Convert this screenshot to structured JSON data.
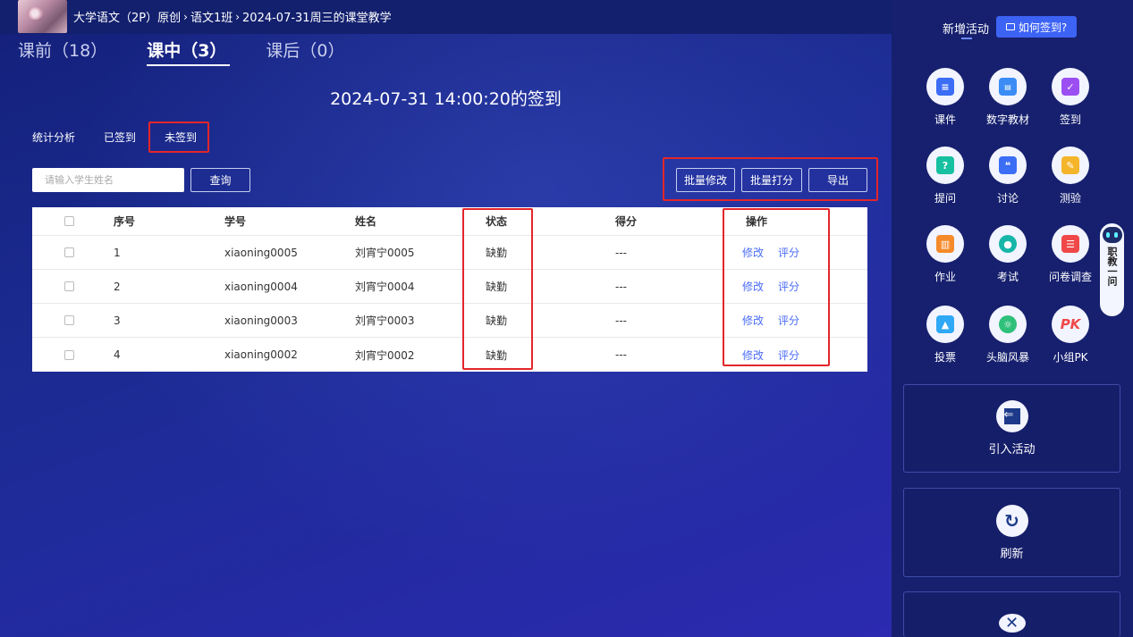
{
  "breadcrumb": {
    "course": "大学语文（2P）原创",
    "sep": "›",
    "class": "语文1班",
    "lesson": "2024-07-31周三的课堂教学"
  },
  "tabs": [
    {
      "label": "课前（18）"
    },
    {
      "label": "课中（3）"
    },
    {
      "label": "课后（0）"
    }
  ],
  "signin_title": "2024-07-31 14:00:20的签到",
  "subtabs": [
    "统计分析",
    "已签到",
    "未签到"
  ],
  "search": {
    "placeholder": "请输入学生姓名",
    "button": "查询"
  },
  "actions": {
    "batch_edit": "批量修改",
    "batch_score": "批量打分",
    "export": "导出"
  },
  "table": {
    "headers": [
      "序号",
      "学号",
      "姓名",
      "状态",
      "得分",
      "操作"
    ],
    "rows": [
      {
        "no": "1",
        "id": "xiaoning0005",
        "name": "刘宵宁0005",
        "status": "缺勤",
        "score": "---",
        "edit": "修改",
        "grade": "评分"
      },
      {
        "no": "2",
        "id": "xiaoning0004",
        "name": "刘宵宁0004",
        "status": "缺勤",
        "score": "---",
        "edit": "修改",
        "grade": "评分"
      },
      {
        "no": "3",
        "id": "xiaoning0003",
        "name": "刘宵宁0003",
        "status": "缺勤",
        "score": "---",
        "edit": "修改",
        "grade": "评分"
      },
      {
        "no": "4",
        "id": "xiaoning0002",
        "name": "刘宵宁0002",
        "status": "缺勤",
        "score": "---",
        "edit": "修改",
        "grade": "评分"
      }
    ]
  },
  "panel": {
    "title": "新增活动",
    "how_button": "如何签到?",
    "tools": [
      {
        "label": "课件",
        "icon": "courseware-icon",
        "color": "#3b6df5"
      },
      {
        "label": "数字教材",
        "icon": "digital-textbook-icon",
        "color": "#3b8cf5"
      },
      {
        "label": "签到",
        "icon": "signin-icon",
        "color": "#9b4ff2"
      },
      {
        "label": "提问",
        "icon": "question-icon",
        "color": "#16c0a0"
      },
      {
        "label": "讨论",
        "icon": "discussion-icon",
        "color": "#3b6df5"
      },
      {
        "label": "测验",
        "icon": "quiz-icon",
        "color": "#f5b52a"
      },
      {
        "label": "作业",
        "icon": "homework-icon",
        "color": "#f58a2a"
      },
      {
        "label": "考试",
        "icon": "exam-icon",
        "color": "#16b6a8"
      },
      {
        "label": "问卷调查",
        "icon": "survey-icon",
        "color": "#f04848"
      },
      {
        "label": "投票",
        "icon": "vote-icon",
        "color": "#2fa8f5"
      },
      {
        "label": "头脑风暴",
        "icon": "brainstorm-icon",
        "color": "#2fc07a"
      },
      {
        "label": "小组PK",
        "icon": "group-pk-icon",
        "color": "#f04848",
        "text": "PK"
      }
    ],
    "import_label": "引入活动",
    "refresh_label": "刷新"
  },
  "robot": {
    "label": "职教一问"
  }
}
